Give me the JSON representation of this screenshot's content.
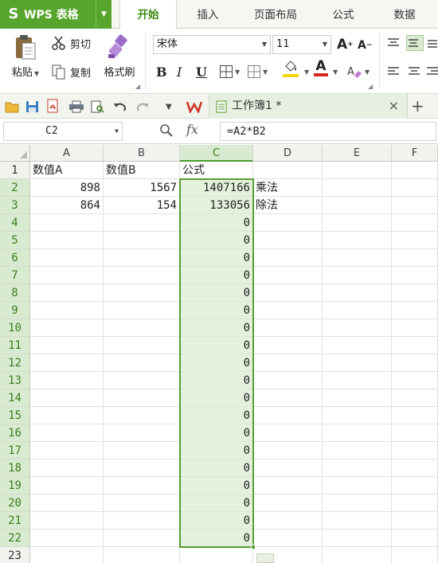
{
  "menubar": {
    "app_logo": "S",
    "app_name": "WPS 表格",
    "tabs": [
      "开始",
      "插入",
      "页面布局",
      "公式",
      "数据"
    ],
    "active_tab": "开始"
  },
  "ribbon": {
    "paste": "粘贴",
    "cut": "剪切",
    "copy": "复制",
    "format_painter": "格式刷",
    "font_name": "宋体",
    "font_size": "11",
    "bold": "B",
    "italic": "I",
    "underline": "U",
    "font_color_letter": "A",
    "increase_font": "A",
    "decrease_font": "A",
    "font_color_hex": "#d8261b",
    "fill_color_hex": "#f5d400"
  },
  "quickbar": {
    "doc_tab_title": "工作簿1 *",
    "close": "×",
    "new_tab": "+"
  },
  "formulabar": {
    "name_box": "C2",
    "fx": "fx",
    "formula": "=A2*B2"
  },
  "sheet": {
    "columns": [
      "A",
      "B",
      "C",
      "D",
      "E",
      "F"
    ],
    "selected_column": "C",
    "rows": [
      {
        "n": "1",
        "A": "数值A",
        "B": "数值B",
        "C": "公式",
        "D": ""
      },
      {
        "n": "2",
        "A": "898",
        "B": "1567",
        "C": "1407166",
        "D": "乘法"
      },
      {
        "n": "3",
        "A": "864",
        "B": "154",
        "C": "133056",
        "D": "除法"
      },
      {
        "n": "4",
        "A": "",
        "B": "",
        "C": "0",
        "D": ""
      },
      {
        "n": "5",
        "A": "",
        "B": "",
        "C": "0",
        "D": ""
      },
      {
        "n": "6",
        "A": "",
        "B": "",
        "C": "0",
        "D": ""
      },
      {
        "n": "7",
        "A": "",
        "B": "",
        "C": "0",
        "D": ""
      },
      {
        "n": "8",
        "A": "",
        "B": "",
        "C": "0",
        "D": ""
      },
      {
        "n": "9",
        "A": "",
        "B": "",
        "C": "0",
        "D": ""
      },
      {
        "n": "10",
        "A": "",
        "B": "",
        "C": "0",
        "D": ""
      },
      {
        "n": "11",
        "A": "",
        "B": "",
        "C": "0",
        "D": ""
      },
      {
        "n": "12",
        "A": "",
        "B": "",
        "C": "0",
        "D": ""
      },
      {
        "n": "13",
        "A": "",
        "B": "",
        "C": "0",
        "D": ""
      },
      {
        "n": "14",
        "A": "",
        "B": "",
        "C": "0",
        "D": ""
      },
      {
        "n": "15",
        "A": "",
        "B": "",
        "C": "0",
        "D": ""
      },
      {
        "n": "16",
        "A": "",
        "B": "",
        "C": "0",
        "D": ""
      },
      {
        "n": "17",
        "A": "",
        "B": "",
        "C": "0",
        "D": ""
      },
      {
        "n": "18",
        "A": "",
        "B": "",
        "C": "0",
        "D": ""
      },
      {
        "n": "19",
        "A": "",
        "B": "",
        "C": "0",
        "D": ""
      },
      {
        "n": "20",
        "A": "",
        "B": "",
        "C": "0",
        "D": ""
      },
      {
        "n": "21",
        "A": "",
        "B": "",
        "C": "0",
        "D": ""
      },
      {
        "n": "22",
        "A": "",
        "B": "",
        "C": "0",
        "D": ""
      },
      {
        "n": "23",
        "A": "",
        "B": "",
        "C": "",
        "D": ""
      }
    ]
  }
}
